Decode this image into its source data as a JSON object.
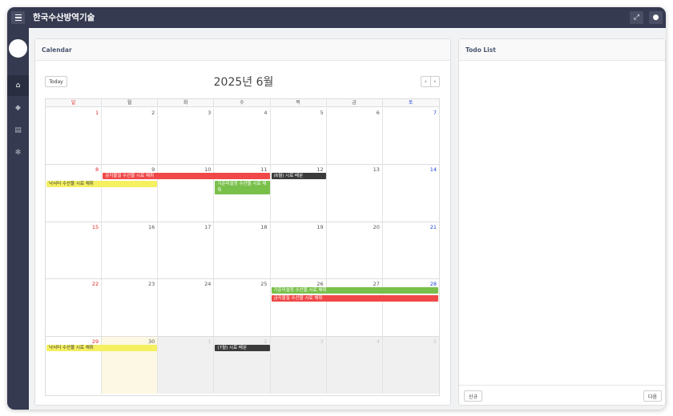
{
  "app": {
    "title": "한국수산방역기술"
  },
  "topbar": {
    "menu_icon": "hamburger-menu-icon",
    "expand_icon": "expand-icon",
    "user_icon": "user-icon"
  },
  "sidebar": {
    "items": [
      {
        "name": "home",
        "icon": "home-icon",
        "glyph": "⌂",
        "active": true
      },
      {
        "name": "tags",
        "icon": "tags-icon",
        "glyph": "◆",
        "active": false
      },
      {
        "name": "document",
        "icon": "document-icon",
        "glyph": "▤",
        "active": false
      },
      {
        "name": "settings",
        "icon": "gear-icon",
        "glyph": "✻",
        "active": false
      }
    ]
  },
  "calendar": {
    "panel_title": "Calendar",
    "today_label": "Today",
    "title": "2025년 6월",
    "prev_label": "‹",
    "next_label": "›",
    "weekdays": [
      "일",
      "월",
      "화",
      "수",
      "목",
      "금",
      "토"
    ],
    "weeks": [
      [
        "1",
        "2",
        "3",
        "4",
        "5",
        "6",
        "7"
      ],
      [
        "8",
        "9",
        "10",
        "11",
        "12",
        "13",
        "14"
      ],
      [
        "15",
        "16",
        "17",
        "18",
        "19",
        "20",
        "21"
      ],
      [
        "22",
        "23",
        "24",
        "25",
        "26",
        "27",
        "28"
      ],
      [
        "29",
        "30",
        "1",
        "2",
        "3",
        "4",
        "5"
      ]
    ],
    "today": "30",
    "events": [
      {
        "title": "금지물질 수산물 시료 채취",
        "week": 1,
        "start": 1,
        "span": 3,
        "row": 0,
        "color": "#f04848",
        "text": "#ffffff"
      },
      {
        "title": "(6월) 시료 배분",
        "week": 1,
        "start": 4,
        "span": 1,
        "row": 0,
        "color": "#3b3b3b",
        "text": "#ffffff"
      },
      {
        "title": "낙서터 수산물 시료 채취",
        "week": 1,
        "start": 0,
        "span": 2,
        "row": 1,
        "color": "#f4f060",
        "text": "#333333"
      },
      {
        "title": "기준미설정 수산물 시료 채취",
        "week": 1,
        "start": 3,
        "span": 1,
        "row": 1,
        "color": "#79c04b",
        "text": "#ffffff",
        "tall": true
      },
      {
        "title": "기준미설정 수산물 시료 채취",
        "week": 3,
        "start": 4,
        "span": 3,
        "row": 0,
        "color": "#79c04b",
        "text": "#ffffff"
      },
      {
        "title": "금지물질 수산물 시료 채취",
        "week": 3,
        "start": 4,
        "span": 3,
        "row": 1,
        "color": "#f04848",
        "text": "#ffffff"
      },
      {
        "title": "낙서터 수산물 시료 채취",
        "week": 4,
        "start": 0,
        "span": 2,
        "row": 0,
        "color": "#f4f060",
        "text": "#333333"
      },
      {
        "title": "(7월) 시료 배분",
        "week": 4,
        "start": 3,
        "span": 1,
        "row": 0,
        "color": "#3b3b3b",
        "text": "#ffffff"
      }
    ]
  },
  "todo": {
    "panel_title": "Todo List",
    "new_label": "신규",
    "next_label": "다음"
  },
  "colors": {
    "sunday": "#e0282a",
    "saturday": "#1f49d8",
    "today_bg": "#fcf8e3",
    "topbar": "#353a50"
  }
}
